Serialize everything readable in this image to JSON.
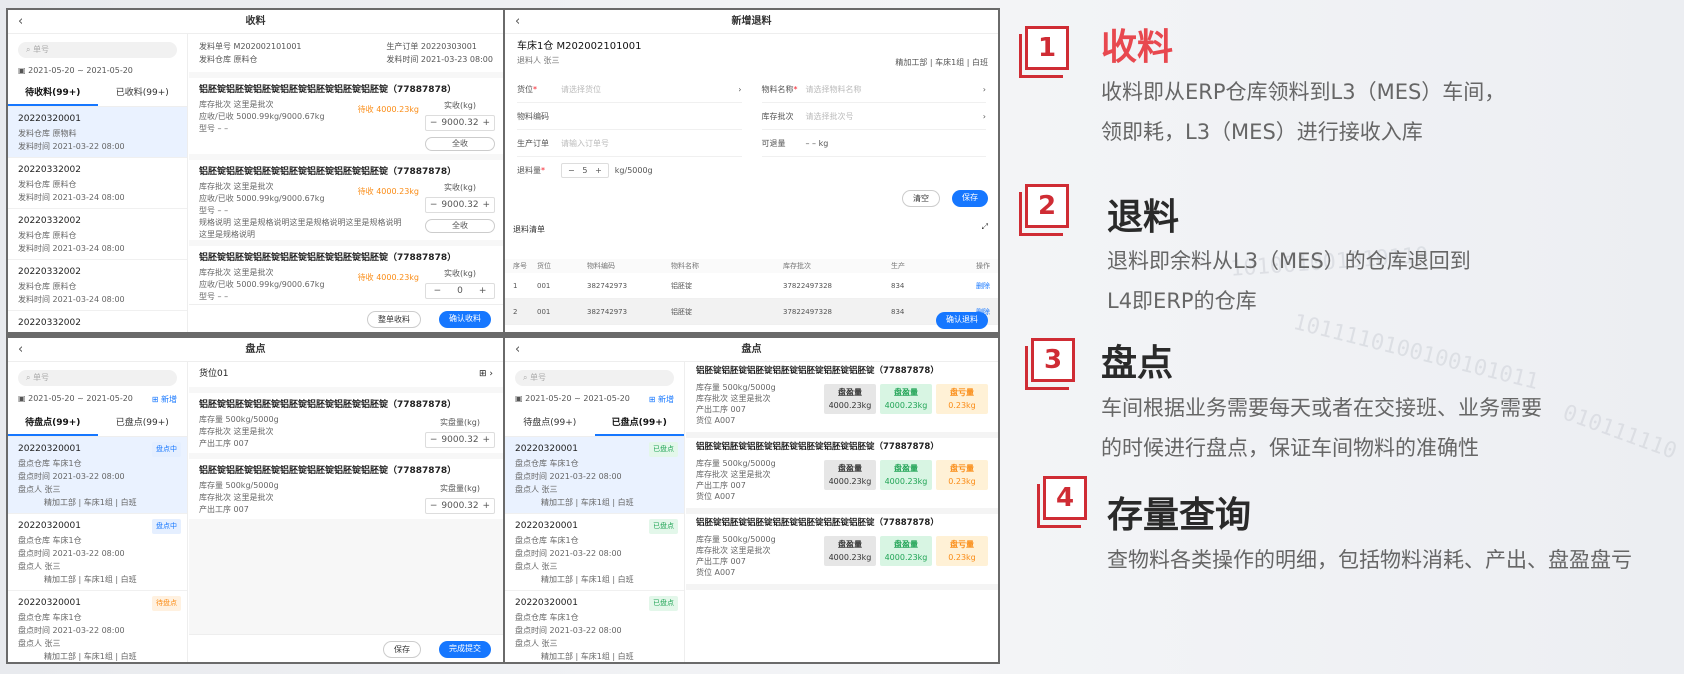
{
  "p1": {
    "title": "收料",
    "search_ph": "单号",
    "date_range": "2021-05-20 ~ 2021-05-20",
    "tab_todo": "待收料(99+)",
    "tab_done": "已收料(99+)",
    "list": [
      {
        "no": "20220320001",
        "r1": "发料仓库  原物料",
        "r2": "发料时间  2021-03-22  08:00"
      },
      {
        "no": "20220332002",
        "r1": "发料仓库  原料仓",
        "r2": "发料时间  2021-03-24  08:00"
      },
      {
        "no": "20220332002",
        "r1": "发料仓库  原料仓",
        "r2": "发料时间  2021-03-24  08:00"
      },
      {
        "no": "20220332002",
        "r1": "发料仓库  原料仓",
        "r2": "发料时间  2021-03-24  08:00"
      },
      {
        "no": "20220332002",
        "r1": "",
        "r2": ""
      }
    ],
    "hdr_l1": "发料单号  M202002101001",
    "hdr_l2": "发料仓库  原料仓",
    "hdr_r1": "生产订单  20220303001",
    "hdr_r2": "发料时间  2021-03-23  08:00",
    "cards": [
      {
        "name": "铝胚锭铝胚锭铝胚锭铝胚锭铝胚锭铝胚锭铝胚锭（77887878）",
        "l1": "库存批次  这里是批次",
        "l2": "应收/已收  5000.99kg/9000.67kg",
        "l3": "型号  – –",
        "l4": "",
        "wait": "待收  4000.23kg",
        "qty_label": "实收(kg)",
        "qty": "9000.32",
        "all": "全收"
      },
      {
        "name": "铝胚锭铝胚锭铝胚锭铝胚锭铝胚锭铝胚锭铝胚锭（77887878）",
        "l1": "库存批次  这里是批次",
        "l2": "应收/已收  5000.99kg/9000.67kg",
        "l3": "型号  – –",
        "l4": "规格说明  这里是规格说明这里是规格说明这里是规格说明 这里是规格说明",
        "wait": "待收  4000.23kg",
        "qty_label": "实收(kg)",
        "qty": "9000.32",
        "all": "全收"
      },
      {
        "name": "铝胚锭铝胚锭铝胚锭铝胚锭铝胚锭铝胚锭铝胚锭（77887878）",
        "l1": "库存批次  这里是批次",
        "l2": "应收/已收  5000.99kg/9000.67kg",
        "l3": "型号  – –",
        "l4": "",
        "wait": "待收  4000.23kg",
        "qty_label": "实收(kg)",
        "qty": "0",
        "all": "全收"
      }
    ],
    "btn_all": "整单收料",
    "btn_confirm": "确认收料"
  },
  "p2": {
    "title": "新增退料",
    "head": "车床1仓  M202002101001",
    "person": "退料人  张三",
    "dept": "精加工部 | 车床1组 | 白班",
    "f_loc": "货位",
    "f_loc_ph": "请选择货位",
    "f_name": "物料名称",
    "f_name_ph": "请选择物料名称",
    "f_code": "物料编码",
    "f_batch": "库存批次",
    "f_batch_ph": "请选择批次号",
    "f_order": "生产订单",
    "f_order_ph": "请输入订单号",
    "f_avail": "可退量",
    "f_avail_val": "– – kg",
    "f_qty": "退料量",
    "f_qty_val": "5",
    "f_qty_unit": "kg/5000g",
    "btn_clear": "清空",
    "btn_save": "保存",
    "list_title": "退料清单",
    "cols": [
      "序号",
      "货位",
      "物料编码",
      "物料名称",
      "库存批次",
      "生产",
      "操作"
    ],
    "rows": [
      [
        "1",
        "001",
        "382742973",
        "铝胚锭",
        "37822497328",
        "834",
        "删除"
      ],
      [
        "2",
        "001",
        "382742973",
        "铝胚锭",
        "37822497328",
        "834",
        "删除"
      ]
    ],
    "btn_confirm": "确认退料"
  },
  "p3": {
    "title": "盘点",
    "search_ph": "单号",
    "date_range": "2021-05-20 ~ 2021-05-20",
    "add": "新增",
    "tab_todo": "待盘点(99+)",
    "tab_done": "已盘点(99+)",
    "list": [
      {
        "no": "20220320001",
        "badge": "盘点中",
        "r1": "盘点仓库  车床1仓",
        "r2": "盘点时间  2021-03-22  08:00",
        "r3": "盘点人  张三",
        "r4": "精加工部 | 车床1组 | 白班"
      },
      {
        "no": "20220320001",
        "badge": "盘点中",
        "r1": "盘点仓库  车床1仓",
        "r2": "盘点时间  2021-03-22  08:00",
        "r3": "盘点人  张三",
        "r4": "精加工部 | 车床1组 | 白班"
      },
      {
        "no": "20220320001",
        "badge": "待盘点",
        "r1": "盘点仓库  车床1仓",
        "r2": "盘点时间  2021-03-22  08:00",
        "r3": "盘点人  张三",
        "r4": "精加工部 | 车床1组 | 白班"
      }
    ],
    "loc": "货位01",
    "cards": [
      {
        "name": "铝胚锭铝胚锭铝胚锭铝胚锭铝胚锭铝胚锭铝胚锭（77887878）",
        "l1": "库存量  500kg/5000g",
        "l2": "库存批次  这里是批次",
        "l3": "产出工序  007",
        "qty_label": "实盘量(kg)",
        "qty": "9000.32"
      },
      {
        "name": "铝胚锭铝胚锭铝胚锭铝胚锭铝胚锭铝胚锭铝胚锭（77887878）",
        "l1": "库存量  500kg/5000g",
        "l2": "库存批次  这里是批次",
        "l3": "产出工序  007",
        "qty_label": "实盘量(kg)",
        "qty": "9000.32"
      }
    ],
    "btn_save": "保存",
    "btn_submit": "完成提交"
  },
  "p4": {
    "title": "盘点",
    "search_ph": "单号",
    "date_range": "2021-05-20 ~ 2021-05-20",
    "add": "新增",
    "tab_todo": "待盘点(99+)",
    "tab_done": "已盘点(99+)",
    "list": [
      {
        "no": "20220320001",
        "badge": "已盘点",
        "r1": "盘点仓库  车床1仓",
        "r2": "盘点时间  2021-03-22  08:00",
        "r3": "盘点人  张三",
        "r4": "精加工部 | 车床1组 | 白班"
      },
      {
        "no": "20220320001",
        "badge": "已盘点",
        "r1": "盘点仓库  车床1仓",
        "r2": "盘点时间  2021-03-22  08:00",
        "r3": "盘点人  张三",
        "r4": "精加工部 | 车床1组 | 白班"
      },
      {
        "no": "20220320001",
        "badge": "已盘点",
        "r1": "盘点仓库  车床1仓",
        "r2": "盘点时间  2021-03-22  08:00",
        "r3": "盘点人  张三",
        "r4": "精加工部 | 车床1组 | 白班"
      }
    ],
    "cards": [
      {
        "name": "铝胚锭铝胚锭铝胚锭铝胚锭铝胚锭铝胚锭铝胚锭（77887878）",
        "l1": "库存量  500kg/5000g",
        "l2": "库存批次  这里是批次",
        "l3": "产出工序  007",
        "l4": "货位  A007",
        "s1l": "盘盈量",
        "s1": "4000.23kg",
        "s2l": "盘盈量",
        "s2": "4000.23kg",
        "s3l": "盘亏量",
        "s3": "0.23kg"
      },
      {
        "name": "铝胚锭铝胚锭铝胚锭铝胚锭铝胚锭铝胚锭铝胚锭（77887878）",
        "l1": "库存量  500kg/5000g",
        "l2": "库存批次  这里是批次",
        "l3": "产出工序  007",
        "l4": "货位  A007",
        "s1l": "盘盈量",
        "s1": "4000.23kg",
        "s2l": "盘盈量",
        "s2": "4000.23kg",
        "s3l": "盘亏量",
        "s3": "0.23kg"
      },
      {
        "name": "铝胚锭铝胚锭铝胚锭铝胚锭铝胚锭铝胚锭铝胚锭（77887878）",
        "l1": "库存量  500kg/5000g",
        "l2": "库存批次  这里是批次",
        "l3": "产出工序  007",
        "l4": "货位  A007",
        "s1l": "盘盈量",
        "s1": "4000.23kg",
        "s2l": "盘盈量",
        "s2": "4000.23kg",
        "s3l": "盘亏量",
        "s3": "0.23kg"
      }
    ]
  },
  "features": [
    {
      "num": "1",
      "title": "收料",
      "desc1": "收料即从ERP仓库领料到L3（MES）车间，",
      "desc2": "领即耗，L3（MES）进行接收入库"
    },
    {
      "num": "2",
      "title": "退料",
      "desc1": "退料即余料从L3（MES）的仓库退回到",
      "desc2": "L4即ERP的仓库"
    },
    {
      "num": "3",
      "title": "盘点",
      "desc1": "车间根据业务需要每天或者在交接班、业务需要",
      "desc2": "的时候进行盘点，保证车间物料的准确性"
    },
    {
      "num": "4",
      "title": "存量查询",
      "desc1": "查物料各类操作的明细，包括物料消耗、产出、盘盈盘亏",
      "desc2": ""
    }
  ],
  "colors": {
    "accent": "#1677ff",
    "brand_red": "#cf2c34",
    "title_red": "#e8484f",
    "wait_orange": "#fa8c16"
  },
  "deco": [
    "101001001010110",
    "1011110100100101011",
    "010111110"
  ]
}
